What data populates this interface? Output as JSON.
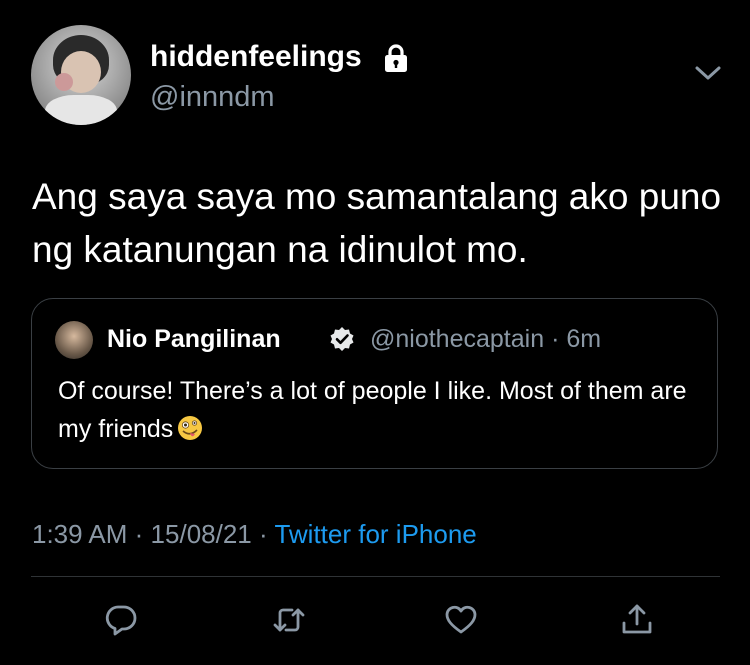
{
  "tweet": {
    "display_name": "hiddenfeelings",
    "handle": "@innndm",
    "text": "Ang saya saya mo samantalang ako puno ng katanungan na idinulot mo.",
    "timestamp": "1:39 AM",
    "date": "15/08/21",
    "separator": "·",
    "client": "Twitter for iPhone",
    "protected_icon": "lock-icon",
    "menu_icon": "chevron-down-icon"
  },
  "quoted_tweet": {
    "display_name": "Nio Pangilinan",
    "handle": "@niothecaptain",
    "separator": "·",
    "age": "6m",
    "text": "Of course! There’s a lot of people I like. Most of them are my friends",
    "emoji": "zany-face-emoji",
    "verified_icon": "verified-badge-icon"
  },
  "actions": [
    {
      "name": "reply",
      "icon": "reply-icon"
    },
    {
      "name": "retweet",
      "icon": "retweet-icon"
    },
    {
      "name": "like",
      "icon": "heart-icon"
    },
    {
      "name": "share",
      "icon": "share-icon"
    }
  ],
  "colors": {
    "background": "#000000",
    "text": "#ffffff",
    "secondary": "#8b98a5",
    "link": "#1d9bf0",
    "border": "#3a3f44"
  }
}
